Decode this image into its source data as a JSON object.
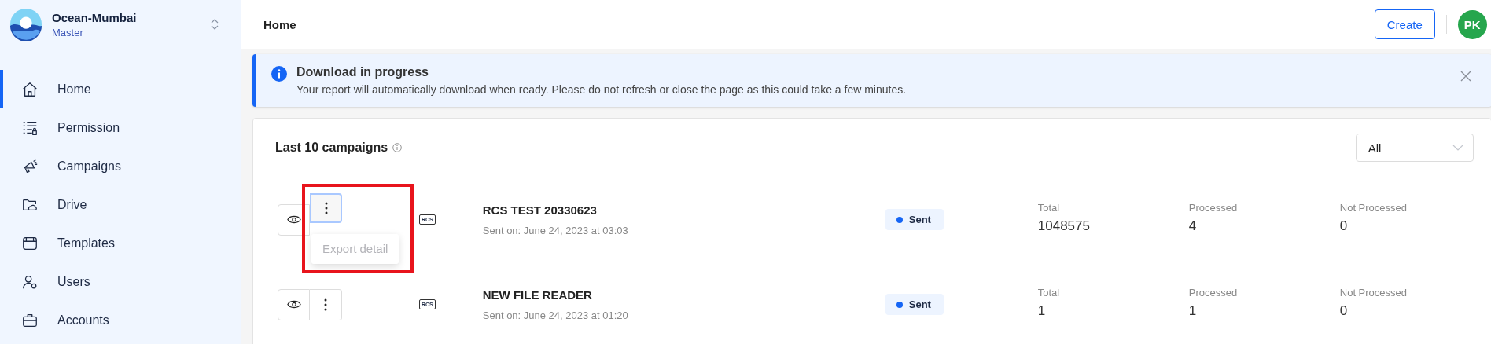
{
  "org": {
    "name": "Ocean-Mumbai",
    "role": "Master"
  },
  "nav": [
    {
      "label": "Home",
      "selected": true
    },
    {
      "label": "Permission",
      "selected": false
    },
    {
      "label": "Campaigns",
      "selected": false
    },
    {
      "label": "Drive",
      "selected": false
    },
    {
      "label": "Templates",
      "selected": false
    },
    {
      "label": "Users",
      "selected": false
    },
    {
      "label": "Accounts",
      "selected": false
    }
  ],
  "header": {
    "title": "Home",
    "create": "Create",
    "avatar": "PK"
  },
  "alert": {
    "title": "Download in progress",
    "message": "Your report will automatically download when ready. Please do not refresh or close the page as this could take a few minutes."
  },
  "campaigns": {
    "title": "Last 10 campaigns",
    "filter": "All",
    "rows": [
      {
        "name": "RCS TEST 20330623",
        "sent_on": "Sent on: June 24, 2023 at 03:03",
        "channel": "RCS",
        "status": "Sent",
        "stats": [
          {
            "label": "Total",
            "value": "1048575"
          },
          {
            "label": "Processed",
            "value": "4"
          },
          {
            "label": "Not Processed",
            "value": "0"
          }
        ],
        "menu": [
          {
            "label": "Export detail",
            "disabled": true
          }
        ]
      },
      {
        "name": "NEW FILE READER",
        "sent_on": "Sent on: June 24, 2023 at 01:20",
        "channel": "RCS",
        "status": "Sent",
        "stats": [
          {
            "label": "Total",
            "value": "1"
          },
          {
            "label": "Processed",
            "value": "1"
          },
          {
            "label": "Not Processed",
            "value": "0"
          }
        ]
      }
    ]
  }
}
